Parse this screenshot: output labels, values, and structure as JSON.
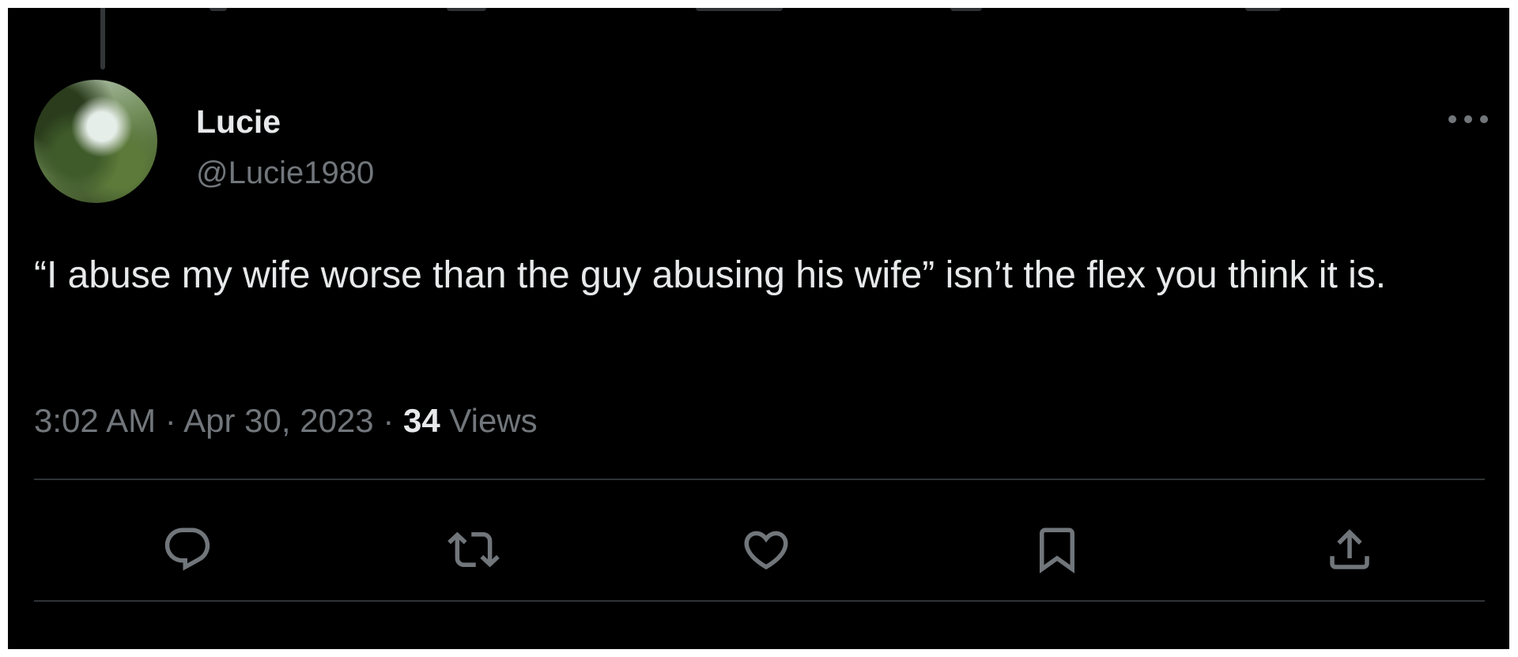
{
  "tweet": {
    "display_name": "Lucie",
    "handle": "@Lucie1980",
    "text": "“I abuse my wife worse than the guy abusing his wife” isn’t the flex you think it is.",
    "time": "3:02 AM",
    "date": "Apr 30, 2023",
    "views_count": "34",
    "views_label": "Views"
  },
  "icons": {
    "more": "more-options-icon",
    "reply": "reply-icon",
    "retweet": "retweet-icon",
    "like": "like-icon",
    "bookmark": "bookmark-icon",
    "share": "share-icon"
  },
  "colors": {
    "background": "#000000",
    "primary_text": "#e7e9ea",
    "secondary_text": "#71767b",
    "divider": "#2f3336"
  }
}
